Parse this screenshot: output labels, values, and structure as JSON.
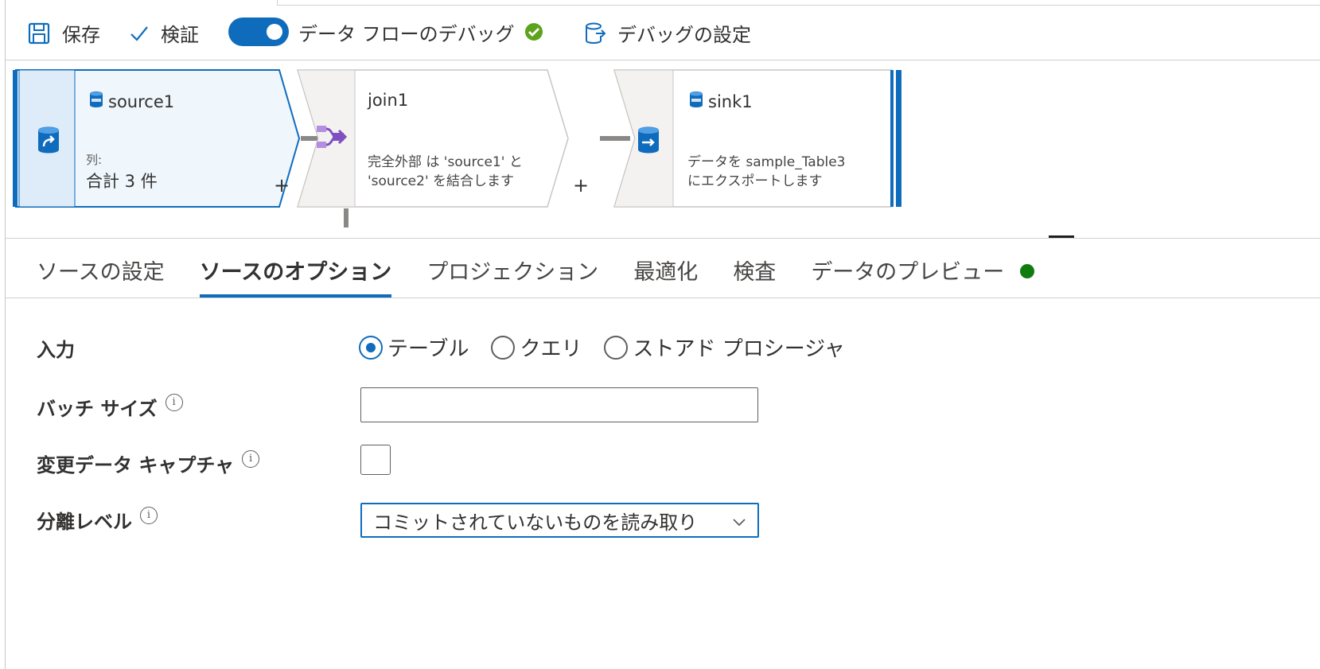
{
  "toolbar": {
    "save_label": "保存",
    "validate_label": "検証",
    "debug_label": "データ フローのデバッグ",
    "debug_settings_label": "デバッグの設定",
    "debug_on": true
  },
  "nodes": [
    {
      "title": "source1",
      "columns_label": "列:",
      "columns_value": "合計 3 件"
    },
    {
      "title": "join1",
      "description_line1": "完全外部 は 'source1' と",
      "description_line2": "'source2' を結合します"
    },
    {
      "title": "sink1",
      "description_line1": "データを sample_Table3",
      "description_line2": "にエクスポートします"
    }
  ],
  "plus_symbol": "+",
  "tabs": [
    {
      "label": "ソースの設定",
      "active": false
    },
    {
      "label": "ソースのオプション",
      "active": true
    },
    {
      "label": "プロジェクション",
      "active": false
    },
    {
      "label": "最適化",
      "active": false
    },
    {
      "label": "検査",
      "active": false
    },
    {
      "label": "データのプレビュー",
      "active": false
    }
  ],
  "form": {
    "input_label": "入力",
    "input_options": [
      "テーブル",
      "クエリ",
      "ストアド プロシージャ"
    ],
    "input_selected": "テーブル",
    "batch_size_label": "バッチ サイズ",
    "batch_size_value": "",
    "cdc_label": "変更データ キャプチャ",
    "cdc_checked": false,
    "isolation_label": "分離レベル",
    "isolation_value": "コミットされていないものを読み取り"
  },
  "info_glyph": "i",
  "colors": {
    "accent": "#0f6cbd",
    "status_green": "#107c10",
    "validation_green": "#5ea31c",
    "join_purple": "#7e50c0"
  }
}
